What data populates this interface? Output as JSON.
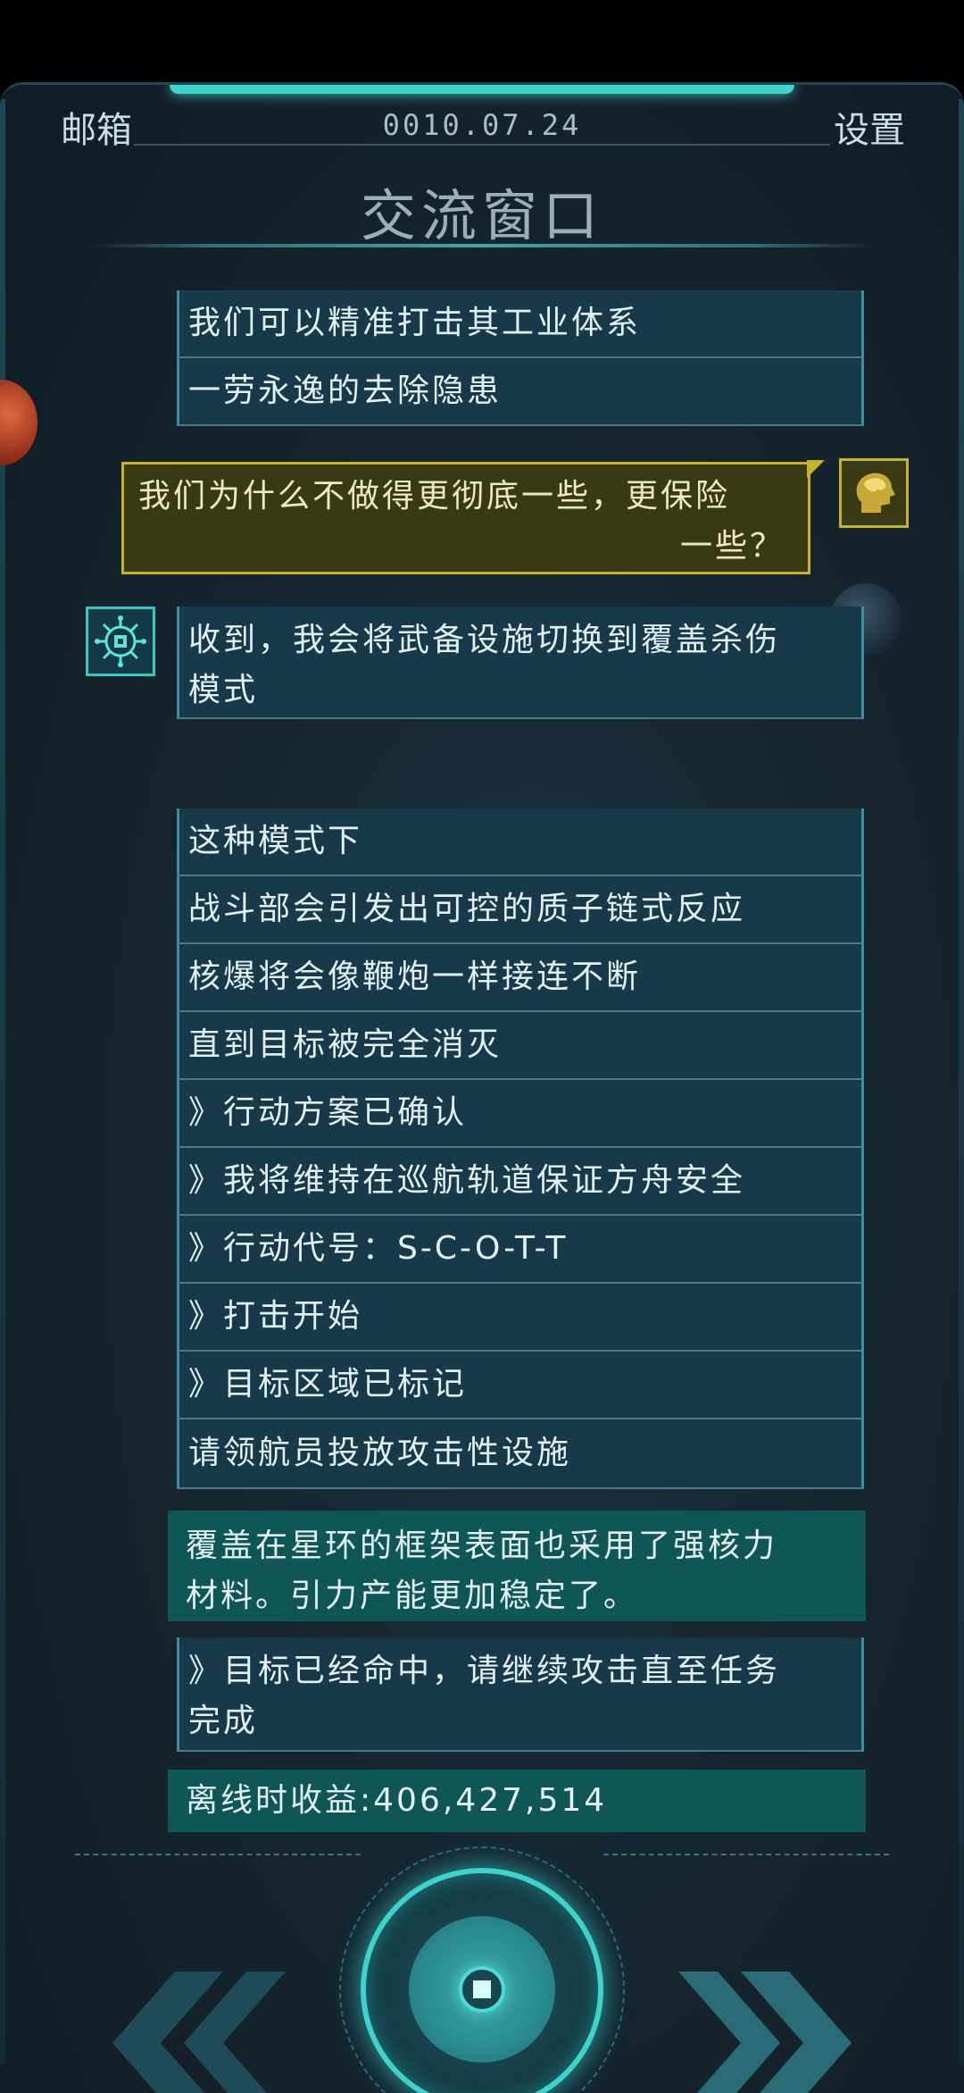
{
  "header": {
    "mail_label": "邮箱",
    "date": "0010.07.24",
    "settings_label": "设置",
    "title": "交流窗口"
  },
  "messages_top": [
    "我们可以精准打击其工业体系",
    "一劳永逸的去除隐患"
  ],
  "user_message": {
    "line1": "我们为什么不做得更彻底一些，更保险",
    "line2": "一些？"
  },
  "ai_messages": {
    "first_line1": "收到，我会将武备设施切换到覆盖杀伤",
    "first_line2": "模式",
    "lines": [
      "这种模式下",
      "战斗部会引发出可控的质子链式反应",
      "核爆将会像鞭炮一样接连不断",
      "直到目标被完全消灭",
      "》行动方案已确认",
      "》我将维持在巡航轨道保证方舟安全",
      "》行动代号：S-C-O-T-T",
      "》打击开始",
      "》目标区域已标记",
      "请领航员投放攻击性设施"
    ]
  },
  "notice": {
    "line1": "覆盖在星环的框架表面也采用了强核力",
    "line2": "材料。引力产能更加稳定了。"
  },
  "result_message": {
    "line1": "》目标已经命中，请继续攻击直至任务",
    "line2": "完成"
  },
  "offline_income": "离线时收益:406,427,514",
  "icons": {
    "user_avatar": "human-head-brain-icon",
    "ai_avatar": "ai-chip-icon",
    "prev": "double-chevron-left-icon",
    "next": "double-chevron-right-icon",
    "center": "core-button-icon"
  },
  "colors": {
    "accent": "#3fd1cb",
    "user_bubble_border": "#c6b22d",
    "message_bg": "#17394a",
    "notice_bg": "#0f5654"
  }
}
